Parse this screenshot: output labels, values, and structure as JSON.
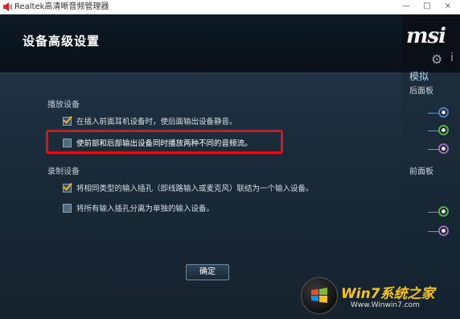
{
  "window": {
    "title": "Realtek高清晰音频管理器",
    "minimize_glyph": "—",
    "maximize_glyph": "□",
    "close_glyph": "×"
  },
  "page": {
    "title": "设备高级设置"
  },
  "playback": {
    "section_label": "播放设备",
    "options": [
      {
        "label": "在插入前面耳机设备时，使后面输出设备静音。",
        "checked": true,
        "highlighted": false
      },
      {
        "label": "使前部和后部输出设备同时播放两种不同的音频流。",
        "checked": false,
        "highlighted": true
      }
    ]
  },
  "recording": {
    "section_label": "录制设备",
    "options": [
      {
        "label": "将相同类型的输入插孔（即线路输入或麦克风）联结为一个输入设备。",
        "checked": true
      },
      {
        "label": "将所有输入插孔分离为单独的输入设备。",
        "checked": false
      }
    ]
  },
  "ok_button": {
    "label": "确定"
  },
  "side_panel": {
    "brand": "msi",
    "analog_label": "模拟",
    "rear_label": "后面板",
    "front_label": "前面板",
    "icons": [
      "gear-icon",
      "info-icon"
    ],
    "rear_jacks": [
      "blue",
      "green",
      "pink"
    ],
    "front_jacks": [
      "green",
      "pink"
    ]
  },
  "watermark": {
    "text": "Win7系统之家",
    "url": "Www.Winwin7.com"
  },
  "colors": {
    "highlight_border": "#e0101a",
    "checkmark": "#f0b323",
    "jack_blue": "#4f7fc9",
    "jack_green": "#4db34a",
    "jack_pink": "#9d6dbb"
  }
}
